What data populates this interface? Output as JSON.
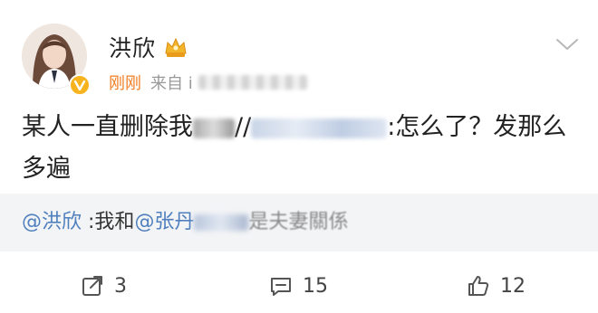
{
  "post": {
    "username": "洪欣",
    "time": "刚刚",
    "source_label": "来自 i",
    "content": {
      "part1": "某人一直删除我",
      "part2": "//",
      "part3": ":怎么了？发那么多遍"
    },
    "repost": {
      "mention1": "@洪欣",
      "text1": ":我和",
      "mention2": "@张丹",
      "text2": "是夫妻關係"
    },
    "actions": {
      "share_count": "3",
      "comment_count": "15",
      "like_count": "12"
    }
  },
  "icons": {
    "badge": "vip-badge-icon",
    "crown": "crown-icon",
    "more": "chevron-down-icon",
    "share": "share-icon",
    "comment": "comment-icon",
    "like": "thumbs-up-icon"
  },
  "colors": {
    "time": "#f17d22",
    "mention": "#4f7fbd",
    "repost_bg": "#f3f4f6",
    "badge": "#f6b31d"
  }
}
